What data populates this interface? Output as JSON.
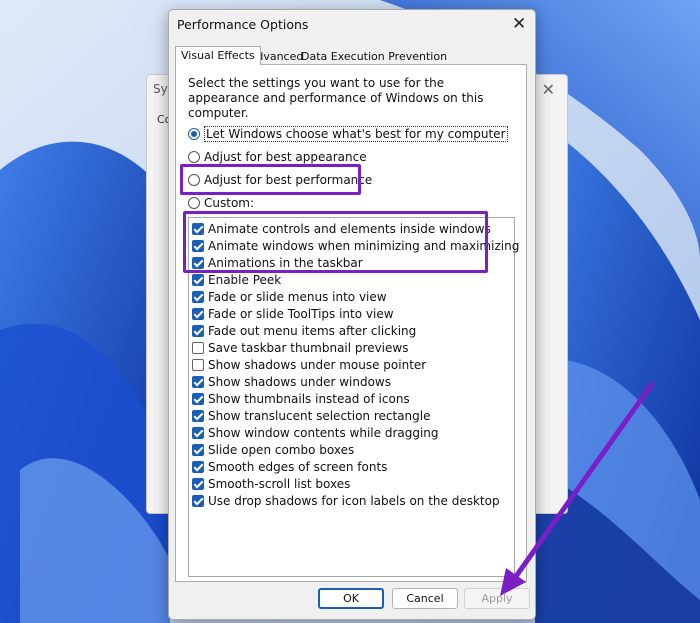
{
  "background_window": {
    "title": "Sys",
    "tab_fragment": "Co",
    "close_glyph": "✕"
  },
  "dialog": {
    "title": "Performance Options",
    "close_glyph": "✕",
    "tabs": [
      {
        "label": "Visual Effects",
        "active": true
      },
      {
        "label": "Advanced",
        "active": false
      },
      {
        "label": "Data Execution Prevention",
        "active": false
      }
    ],
    "description": "Select the settings you want to use for the appearance and performance of Windows on this computer.",
    "radios": [
      {
        "label": "Let Windows choose what's best for my computer",
        "selected": true
      },
      {
        "label": "Adjust for best appearance",
        "selected": false
      },
      {
        "label": "Adjust for best performance",
        "selected": false
      },
      {
        "label": "Custom:",
        "selected": false
      }
    ],
    "checkboxes": [
      {
        "label": "Animate controls and elements inside windows",
        "checked": true
      },
      {
        "label": "Animate windows when minimizing and maximizing",
        "checked": true
      },
      {
        "label": "Animations in the taskbar",
        "checked": true
      },
      {
        "label": "Enable Peek",
        "checked": true
      },
      {
        "label": "Fade or slide menus into view",
        "checked": true
      },
      {
        "label": "Fade or slide ToolTips into view",
        "checked": true
      },
      {
        "label": "Fade out menu items after clicking",
        "checked": true
      },
      {
        "label": "Save taskbar thumbnail previews",
        "checked": false
      },
      {
        "label": "Show shadows under mouse pointer",
        "checked": false
      },
      {
        "label": "Show shadows under windows",
        "checked": true
      },
      {
        "label": "Show thumbnails instead of icons",
        "checked": true
      },
      {
        "label": "Show translucent selection rectangle",
        "checked": true
      },
      {
        "label": "Show window contents while dragging",
        "checked": true
      },
      {
        "label": "Slide open combo boxes",
        "checked": true
      },
      {
        "label": "Smooth edges of screen fonts",
        "checked": true
      },
      {
        "label": "Smooth-scroll list boxes",
        "checked": true
      },
      {
        "label": "Use drop shadows for icon labels on the desktop",
        "checked": true
      }
    ],
    "buttons": {
      "ok": "OK",
      "cancel": "Cancel",
      "apply": "Apply"
    }
  },
  "colors": {
    "accent": "#1a5fb4",
    "highlight": "#7a1fc6"
  }
}
